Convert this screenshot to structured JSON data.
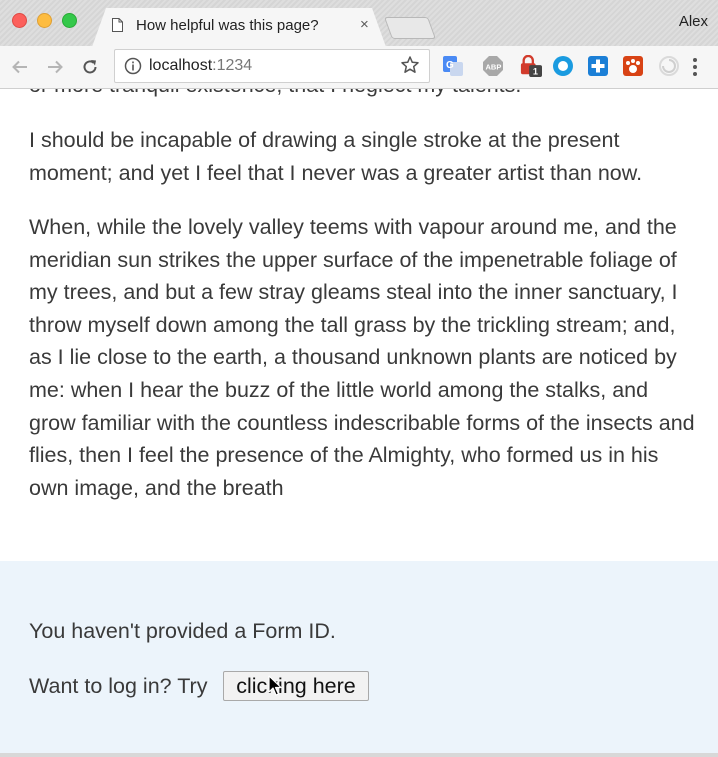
{
  "window": {
    "tab_title": "How helpful was this page?",
    "tab_close": "×",
    "profile_name": "Alex"
  },
  "toolbar": {
    "url_host": "localhost",
    "url_port": ":1234",
    "extensions": [
      "translate-icon",
      "abp-icon",
      "lock-badge-icon",
      "circle-icon",
      "plus-icon",
      "paw-icon",
      "swirl-icon"
    ],
    "badge_count": "1",
    "abp_label": "ABP"
  },
  "content": {
    "partial_line": "or more tranquil existence, that I neglect my talents.",
    "paragraph_2": "I should be incapable of drawing a single stroke at the present moment; and yet I feel that I never was a greater artist than now.",
    "paragraph_3": "When, while the lovely valley teems with vapour around me, and the meridian sun strikes the upper surface of the impenetrable foliage of my trees, and but a few stray gleams steal into the inner sanctuary, I throw myself down among the tall grass by the trickling stream; and, as I lie close to the earth, a thousand unknown plants are noticed by me: when I hear the buzz of the little world among the stalks, and grow familiar with the countless indescribable forms of the insects and flies, then I feel the presence of the Almighty, who formed us in his own image, and the breath"
  },
  "feedback": {
    "no_form_message": "You haven't provided a Form ID.",
    "login_prompt": "Want to log in? Try",
    "login_button": "clicking here"
  },
  "colors": {
    "feedback_bg": "#ecf4fb",
    "text": "#3a3a3a"
  }
}
